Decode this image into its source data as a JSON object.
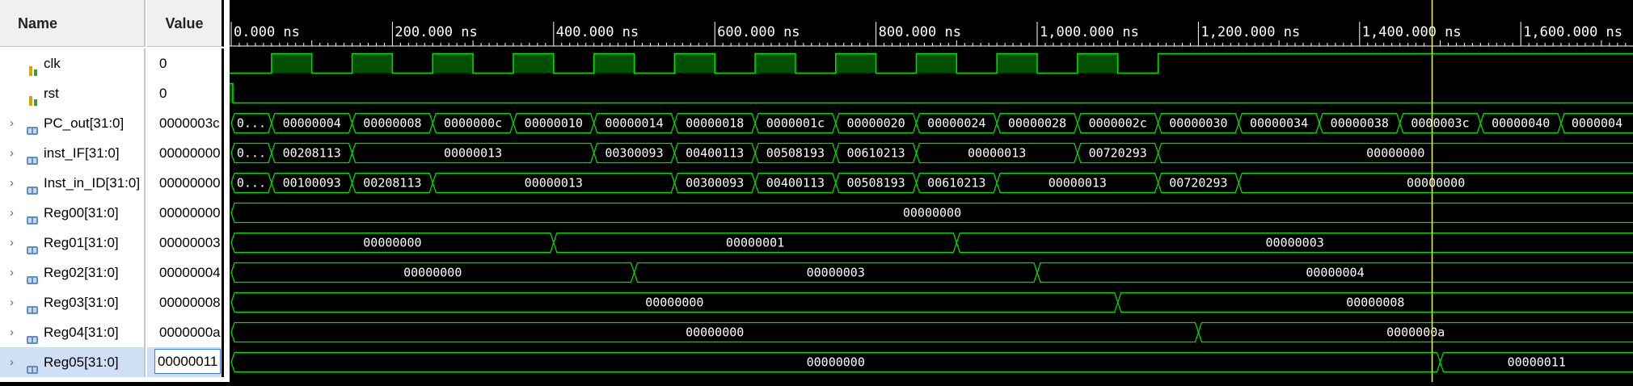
{
  "columns": {
    "name": "Name",
    "value": "Value"
  },
  "signals": [
    {
      "name": "clk",
      "value": "0",
      "type": "bit",
      "icon": "bit-signal-icon"
    },
    {
      "name": "rst",
      "value": "0",
      "type": "bit",
      "icon": "bit-signal-icon"
    },
    {
      "name": "PC_out[31:0]",
      "value": "0000003c",
      "type": "bus",
      "icon": "bus-signal-icon",
      "segments": [
        "0...",
        "00000004",
        "00000008",
        "0000000c",
        "00000010",
        "00000014",
        "00000018",
        "0000001c",
        "00000020",
        "00000024",
        "00000028",
        "0000002c",
        "00000030",
        "00000034",
        "00000038",
        "0000003c",
        "00000040",
        "0000004"
      ]
    },
    {
      "name": "inst_IF[31:0]",
      "value": "00000000",
      "type": "bus",
      "icon": "bus-signal-icon",
      "segments": [
        "0...",
        "00208113",
        "00000013",
        "00300093",
        "00400113",
        "00508193",
        "00610213",
        "00000013",
        "00720293",
        "00000000"
      ]
    },
    {
      "name": "Inst_in_ID[31:0]",
      "value": "00000000",
      "type": "bus",
      "icon": "bus-signal-icon",
      "segments": [
        "0...",
        "00100093",
        "00208113",
        "00000013",
        "00300093",
        "00400113",
        "00508193",
        "00610213",
        "00000013",
        "00720293",
        "00000000"
      ]
    },
    {
      "name": "Reg00[31:0]",
      "value": "00000000",
      "type": "bus",
      "icon": "bus-signal-icon",
      "segments": [
        "00000000"
      ]
    },
    {
      "name": "Reg01[31:0]",
      "value": "00000003",
      "type": "bus",
      "icon": "bus-signal-icon",
      "segments": [
        "00000000",
        "00000001",
        "00000003"
      ]
    },
    {
      "name": "Reg02[31:0]",
      "value": "00000004",
      "type": "bus",
      "icon": "bus-signal-icon",
      "segments": [
        "00000000",
        "00000003",
        "00000004"
      ]
    },
    {
      "name": "Reg03[31:0]",
      "value": "00000008",
      "type": "bus",
      "icon": "bus-signal-icon",
      "segments": [
        "00000000",
        "00000008"
      ]
    },
    {
      "name": "Reg04[31:0]",
      "value": "0000000a",
      "type": "bus",
      "icon": "bus-signal-icon",
      "segments": [
        "00000000",
        "0000000a"
      ]
    },
    {
      "name": "Reg05[31:0]",
      "value": "00000011",
      "type": "bus",
      "icon": "bus-signal-icon",
      "segments": [
        "00000000",
        "00000011"
      ]
    }
  ],
  "timeline": {
    "ticks": [
      "0.000 ns",
      "200.000 ns",
      "400.000 ns",
      "600.000 ns",
      "800.000 ns",
      "1,000.000 ns",
      "1,200.000 ns",
      "1,400.000 ns",
      "1,600.000 ns"
    ],
    "cursor_ns": 1490
  },
  "colors": {
    "wave": "#00e000",
    "clk_fill": "#005000",
    "bus_fill": "#000000",
    "cursor": "#ffff00",
    "ruler_text": "#ffffff"
  }
}
